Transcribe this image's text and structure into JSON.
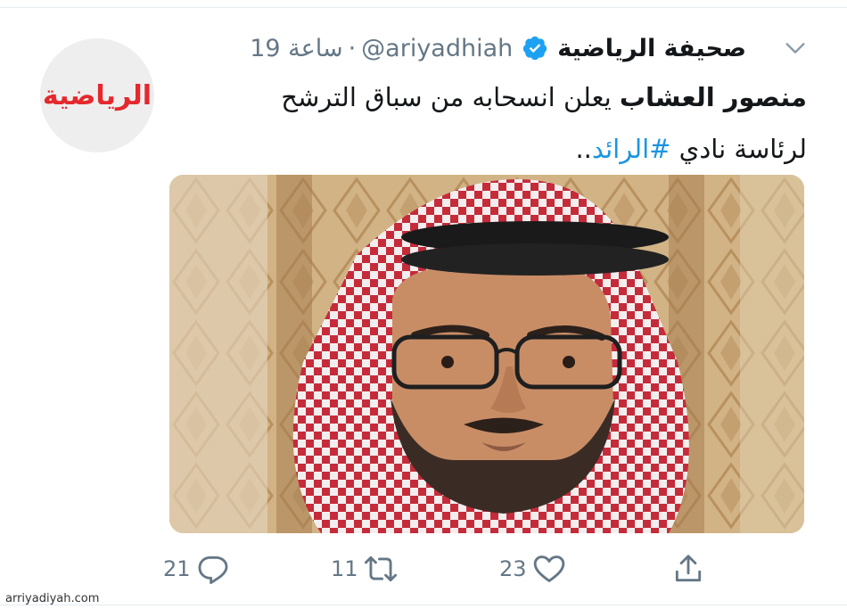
{
  "tweet": {
    "display_name": "صحيفة الرياضية",
    "handle": "@ariyadhiah",
    "separator": "·",
    "time": "19 ساعة",
    "verified_icon": "verified-badge-icon",
    "menu_icon": "chevron-down-icon",
    "avatar_logo_text": "الرياضية",
    "text_line1_bold": "منصور العشاب",
    "text_line1_rest": " يعلن انسحابه من سباق الترشح",
    "text_line2_prefix": "لرئاسة نادي ",
    "hashtag": "#الرائد",
    "text_line2_suffix": "..",
    "photo_icon": "man-in-shemagh-photo",
    "actions": {
      "reply_count": "21",
      "retweet_count": "11",
      "like_count": "23",
      "reply_icon": "reply-icon",
      "retweet_icon": "retweet-icon",
      "like_icon": "heart-icon",
      "share_icon": "share-icon"
    }
  },
  "colors": {
    "accent": "#1da1f2",
    "hashtag": "#1b95e0",
    "muted": "#657786",
    "logo_red": "#e5282d"
  },
  "watermark": "arriyadiyah.com"
}
